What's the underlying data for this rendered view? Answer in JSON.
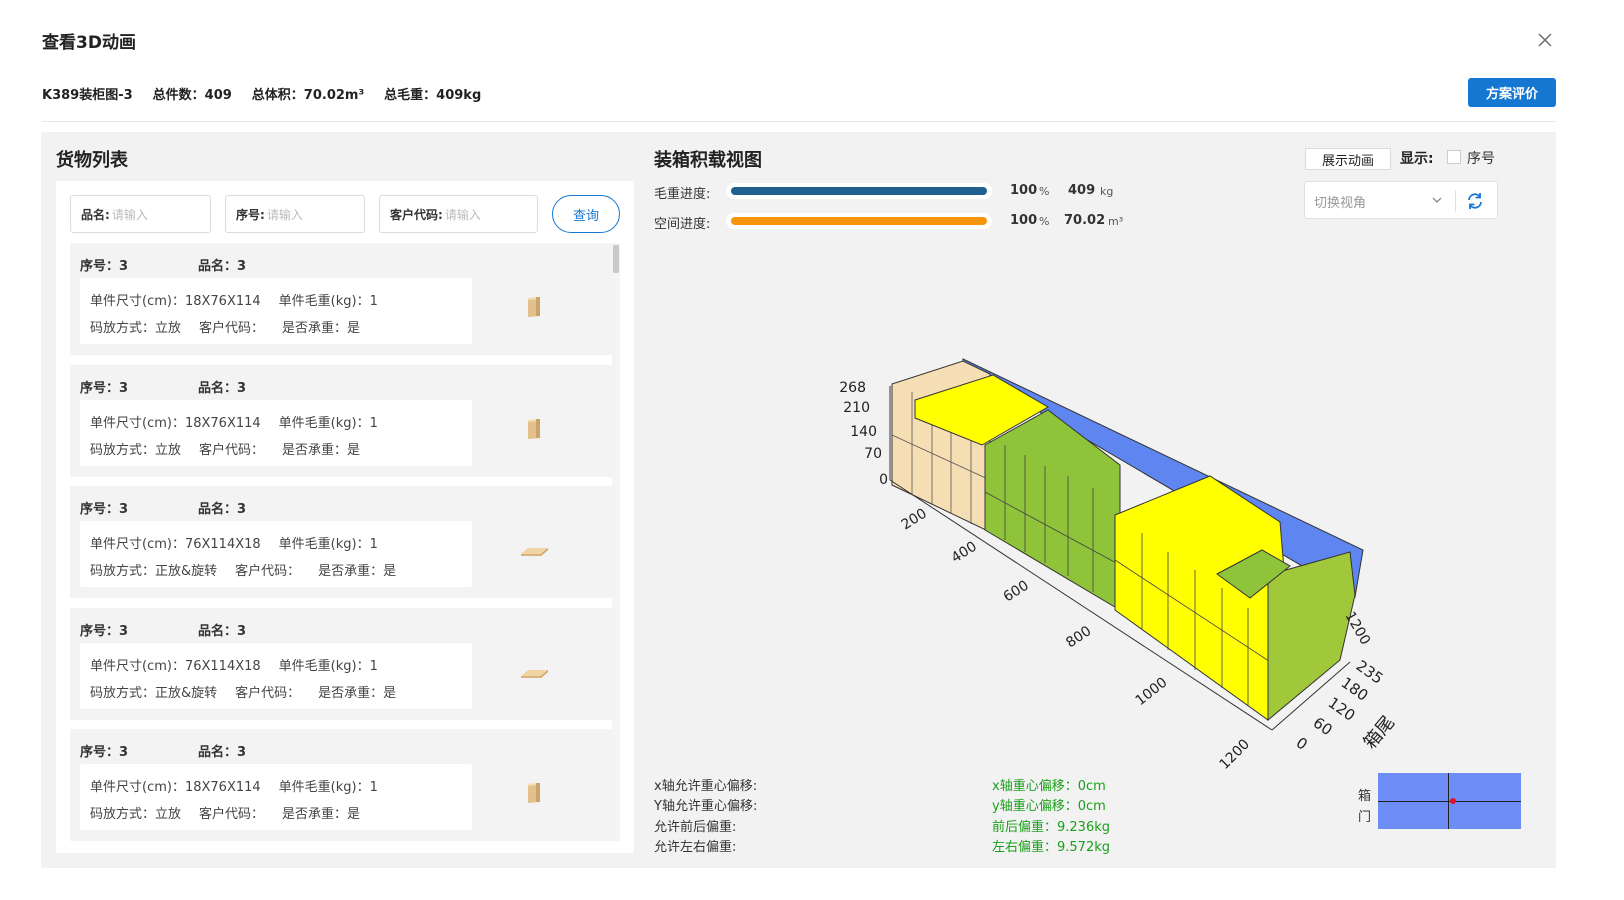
{
  "dialog": {
    "title": "查看3D动画",
    "summary": {
      "name": "K389装柜图-3",
      "total_count": "总件数：409",
      "total_volume": "总体积：70.02m³",
      "total_weight": "总毛重：409kg"
    },
    "evaluate_button": "方案评价"
  },
  "cargo_list": {
    "title": "货物列表",
    "filters": [
      {
        "label": "品名:",
        "placeholder": "请输入"
      },
      {
        "label": "序号:",
        "placeholder": "请输入"
      },
      {
        "label": "客户代码:",
        "placeholder": "请输入"
      }
    ],
    "query_button": "查询",
    "items": [
      {
        "seq": "序号：3",
        "name": "品名：3",
        "size": "单件尺寸(cm)：18X76X114",
        "weight": "单件毛重(kg)：1",
        "mode": "码放方式：立放",
        "customer": "客户代码：",
        "bearing": "是否承重：是",
        "orientation": "upright"
      },
      {
        "seq": "序号：3",
        "name": "品名：3",
        "size": "单件尺寸(cm)：18X76X114",
        "weight": "单件毛重(kg)：1",
        "mode": "码放方式：立放",
        "customer": "客户代码：",
        "bearing": "是否承重：是",
        "orientation": "upright"
      },
      {
        "seq": "序号：3",
        "name": "品名：3",
        "size": "单件尺寸(cm)：76X114X18",
        "weight": "单件毛重(kg)：1",
        "mode": "码放方式：正放&旋转",
        "customer": "客户代码：",
        "bearing": "是否承重：是",
        "orientation": "flat"
      },
      {
        "seq": "序号：3",
        "name": "品名：3",
        "size": "单件尺寸(cm)：76X114X18",
        "weight": "单件毛重(kg)：1",
        "mode": "码放方式：正放&旋转",
        "customer": "客户代码：",
        "bearing": "是否承重：是",
        "orientation": "flat"
      },
      {
        "seq": "序号：3",
        "name": "品名：3",
        "size": "单件尺寸(cm)：18X76X114",
        "weight": "单件毛重(kg)：1",
        "mode": "码放方式：立放",
        "customer": "客户代码：",
        "bearing": "是否承重：是",
        "orientation": "upright"
      }
    ]
  },
  "load_view": {
    "title": "装箱积载视图",
    "animate_button": "展示动画",
    "show_label": "显示:",
    "seq_checkbox_label": "序号",
    "view_select_placeholder": "切换视角",
    "weight_progress": {
      "label": "毛重进度:",
      "percent": 100,
      "percent_text": "100",
      "percent_unit": "%",
      "value": "409",
      "unit": "kg",
      "color": "#20608f"
    },
    "space_progress": {
      "label": "空间进度:",
      "percent": 100,
      "percent_text": "100",
      "percent_unit": "%",
      "value": "70.02",
      "unit": "m³",
      "color": "#f7940d"
    },
    "axes": {
      "height_ticks": [
        "268",
        "210",
        "140",
        "70",
        "0"
      ],
      "length_ticks": [
        "200",
        "400",
        "600",
        "800",
        "1000",
        "1200"
      ],
      "width_ticks": [
        "0",
        "60",
        "120",
        "180",
        "235"
      ],
      "end_tick": "1200",
      "rear_label": "箱尾"
    },
    "stats": {
      "x_allowed": "x轴允许重心偏移:",
      "y_allowed": "Y轴允许重心偏移:",
      "front_allowed": "允许前后偏重:",
      "side_allowed": "允许左右偏重:",
      "x_offset": "x轴重心偏移：0cm",
      "y_offset": "y轴重心偏移：0cm",
      "front_offset": "前后偏重：9.236kg",
      "side_offset": "左右偏重：9.572kg"
    },
    "door_label_1": "箱",
    "door_label_2": "门"
  },
  "colors": {
    "primary": "#1677d2",
    "success_text": "#1aa01a",
    "container_side": "#5f86f0",
    "cargo_tan": "#f5deb3",
    "cargo_yellow": "#ffff00",
    "cargo_green": "#8fc43a",
    "door_map": "#6f8ef5"
  }
}
